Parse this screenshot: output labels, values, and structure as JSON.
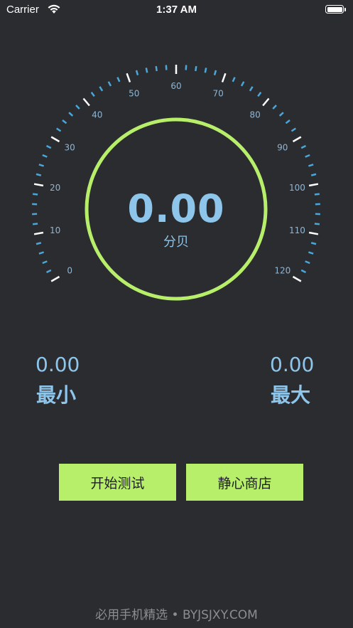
{
  "status_bar": {
    "carrier": "Carrier",
    "time": "1:37 AM"
  },
  "gauge": {
    "scale_labels": [
      "0",
      "10",
      "20",
      "30",
      "40",
      "50",
      "60",
      "70",
      "80",
      "90",
      "100",
      "110",
      "120"
    ],
    "tick_color": "#4aa7d9",
    "major_tick_color": "#ffffff",
    "ring_color": "#b7ef6a",
    "reading": "0.00",
    "unit": "分贝"
  },
  "stats": {
    "min_value": "0.00",
    "min_label": "最小",
    "max_value": "0.00",
    "max_label": "最大"
  },
  "buttons": {
    "start": "开始测试",
    "shop": "静心商店"
  },
  "footer": {
    "watermark": "必用手机精选 • BYJSJXY.COM"
  },
  "colors": {
    "background": "#2b2c30",
    "accent_blue": "#8ec5ea",
    "accent_green": "#b7ef6a"
  }
}
